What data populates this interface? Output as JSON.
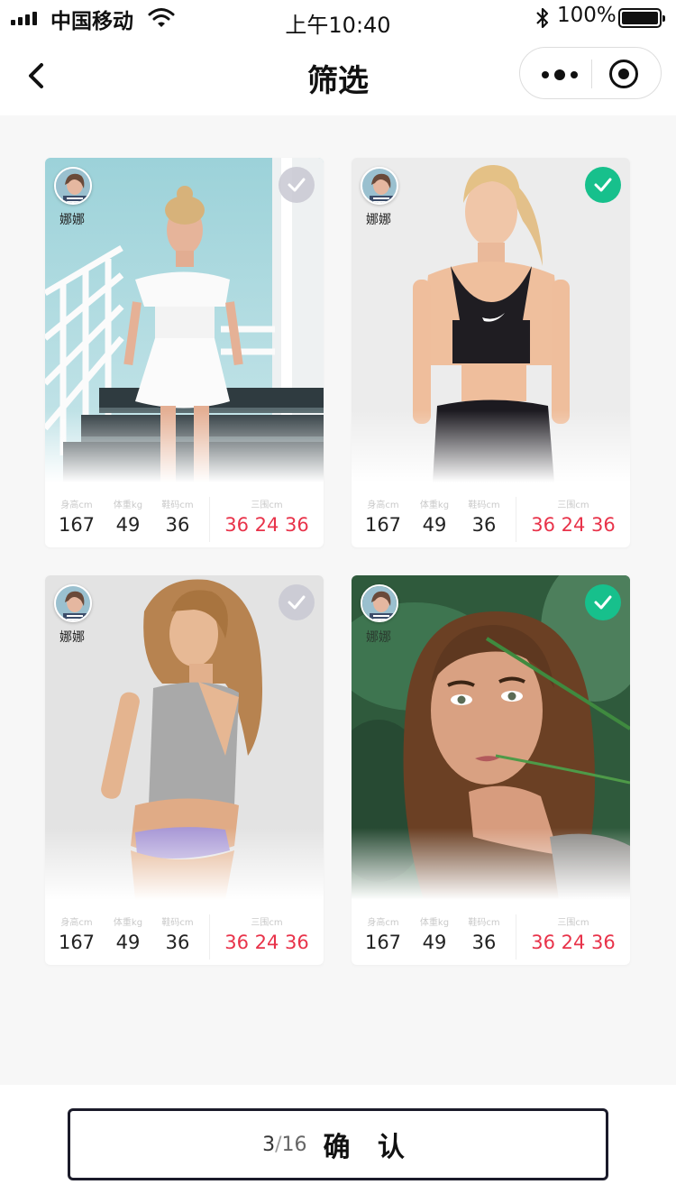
{
  "status_bar": {
    "carrier": "中国移动",
    "time": "上午10:40",
    "battery": "100%"
  },
  "nav": {
    "title": "筛选"
  },
  "cards": [
    {
      "name": "娜娜",
      "selected": false,
      "height_label": "身高cm",
      "height": "167",
      "weight_label": "体重kg",
      "weight": "49",
      "shoe_label": "鞋码cm",
      "shoe": "36",
      "measure_label": "三围cm",
      "measure": "36 24 36"
    },
    {
      "name": "娜娜",
      "selected": true,
      "height_label": "身高cm",
      "height": "167",
      "weight_label": "体重kg",
      "weight": "49",
      "shoe_label": "鞋码cm",
      "shoe": "36",
      "measure_label": "三围cm",
      "measure": "36 24 36"
    },
    {
      "name": "娜娜",
      "selected": false,
      "height_label": "身高cm",
      "height": "167",
      "weight_label": "体重kg",
      "weight": "49",
      "shoe_label": "鞋码cm",
      "shoe": "36",
      "measure_label": "三围cm",
      "measure": "36 24 36"
    },
    {
      "name": "娜娜",
      "selected": true,
      "height_label": "身高cm",
      "height": "167",
      "weight_label": "体重kg",
      "weight": "49",
      "shoe_label": "鞋码cm",
      "shoe": "36",
      "measure_label": "三围cm",
      "measure": "36 24 36"
    }
  ],
  "confirm": {
    "selected_count": "3",
    "separator": "/",
    "total_count": "16",
    "label": "确 认"
  },
  "colors": {
    "accent_green": "#17c08c",
    "measure_red": "#e8334a",
    "unchecked_gray": "#c8c8d2"
  },
  "icons": [
    "signal-icon",
    "wifi-icon",
    "bluetooth-icon",
    "battery-icon",
    "back-arrow-icon",
    "more-dots-icon",
    "target-icon",
    "check-icon"
  ]
}
